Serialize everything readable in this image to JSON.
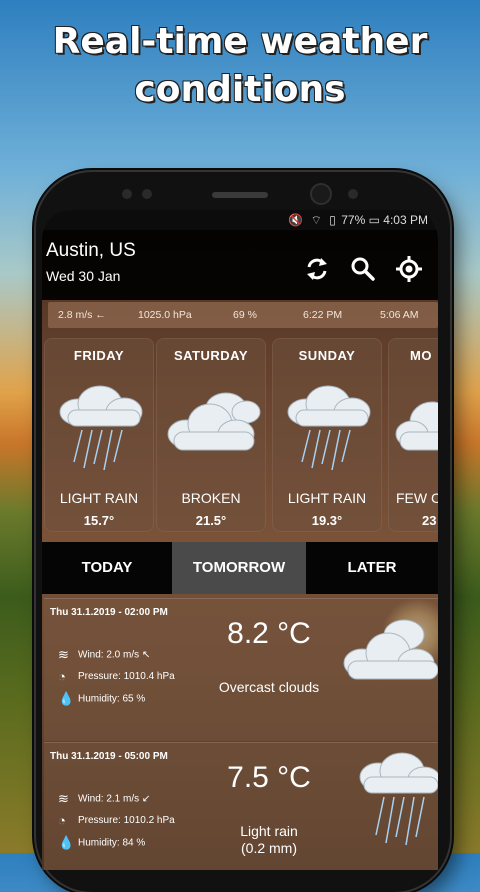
{
  "promo": {
    "line1": "Real-time weather",
    "line2": "conditions"
  },
  "status": {
    "icons": "🔇 ⌔ ▯",
    "battery": "77%",
    "time": "4:03 PM"
  },
  "header": {
    "city": "Austin, US",
    "date": "Wed 30 Jan"
  },
  "info_bar": {
    "wind": "2.8 m/s ←",
    "pressure": "1025.0 hPa",
    "humidity": "69 %",
    "sunset": "6:22 PM",
    "sunrise": "5:06 AM"
  },
  "forecast": [
    {
      "day": "FRIDAY",
      "condition": "LIGHT RAIN",
      "temp": "15.7°",
      "icon": "cloud-rain-icon"
    },
    {
      "day": "SATURDAY",
      "condition": "BROKEN",
      "temp": "21.5°",
      "icon": "cloud-icon"
    },
    {
      "day": "SUNDAY",
      "condition": "LIGHT RAIN",
      "temp": "19.3°",
      "icon": "cloud-rain-icon"
    },
    {
      "day": "MO",
      "condition": "FEW C",
      "temp": "23",
      "icon": "cloud-icon"
    }
  ],
  "tabs": {
    "today": "TODAY",
    "tomorrow": "TOMORROW",
    "later": "LATER",
    "active": "tomorrow"
  },
  "entries": [
    {
      "time": "Thu 31.1.2019 - 02:00 PM",
      "temp": "8.2 °C",
      "description": "Overcast clouds",
      "wind": "Wind: 2.0 m/s ↖",
      "pressure": "Pressure: 1010.4 hPa",
      "humidity": "Humidity: 65 %"
    },
    {
      "time": "Thu 31.1.2019 - 05:00 PM",
      "temp": "7.5 °C",
      "description": "Light rain",
      "description2": "(0.2 mm)",
      "wind": "Wind: 2.1 m/s ↙",
      "pressure": "Pressure: 1010.2 hPa",
      "humidity": "Humidity: 84 %"
    }
  ],
  "colors": {
    "screen_dark": "#0c0c0c",
    "card": "#6e503c",
    "tab_active": "#4a4a4a"
  }
}
